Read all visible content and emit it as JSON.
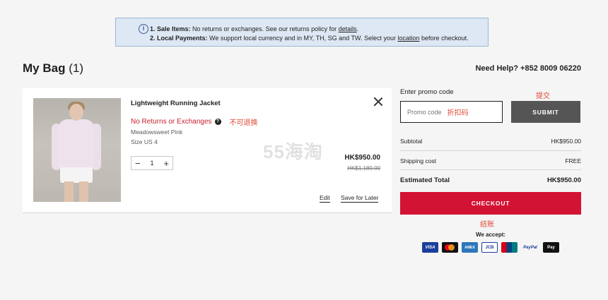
{
  "notice": {
    "line1_bold": "1. Sale Items:",
    "line1_text": " No returns or exchanges. See our returns policy for ",
    "line1_link": "details",
    "line1_end": ".",
    "line2_bold": "2. Local Payments:",
    "line2_text": " We support local currency and in MY, TH, SG and TW. Select your ",
    "line2_link": "location",
    "line2_end": " before checkout."
  },
  "header": {
    "title": "My Bag",
    "count": "(1)",
    "help": "Need Help? +852 8009 06220"
  },
  "item": {
    "name": "Lightweight Running Jacket",
    "no_returns": "No Returns or Exchanges",
    "annotation_no_returns": "不可退换",
    "color": "Meadowsweet Pink",
    "size": "Size US 4",
    "quantity": "1",
    "price": "HK$950.00",
    "original_price": "HK$1,180.00",
    "edit_label": "Edit",
    "save_label": "Save for Later"
  },
  "watermark": "55海淘",
  "promo": {
    "label": "Enter promo code",
    "annotation_submit": "提交",
    "placeholder": "Promo code",
    "annotation_placeholder": "折扣码",
    "submit_label": "SUBMIT"
  },
  "summary": {
    "subtotal_label": "Subtotal",
    "subtotal_value": "HK$950.00",
    "shipping_label": "Shipping cost",
    "shipping_value": "FREE",
    "total_label": "Estimated Total",
    "total_value": "HK$950.00"
  },
  "checkout": {
    "label": "CHECKOUT",
    "annotation": "结账",
    "we_accept": "We accept:"
  },
  "payment_methods": {
    "visa": "VISA",
    "amex": "AMEX",
    "jcb": "JCB",
    "unionpay": "UnionPay",
    "paypal": "PayPal",
    "applepay": "Pay"
  },
  "colors": {
    "accent_red": "#d31334",
    "annotation_red": "#e04a36",
    "notice_bg": "#dde8f4",
    "submit_bg": "#555555"
  }
}
